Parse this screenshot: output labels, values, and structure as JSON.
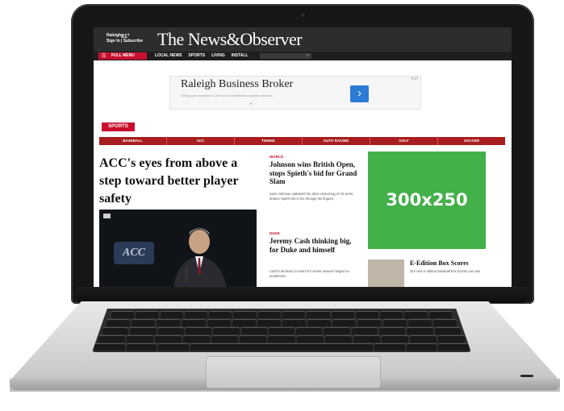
{
  "header": {
    "weather_label": "Raleigh",
    "subscribe_label": "Sign In | Subscribe",
    "temperature": "81°",
    "masthead": "The News&Observer"
  },
  "nav": {
    "menu_label": "FULL MENU",
    "links": [
      "LOCAL NEWS",
      "SPORTS",
      "LIVING",
      "INSTALL"
    ]
  },
  "ad": {
    "title": "Raleigh Business Broker",
    "subtitle": "Selling your business? Call us for confidential complete services",
    "close": "AdX",
    "arrow": "›"
  },
  "section": {
    "tag": "SPORTS",
    "subnav": [
      "BASEBALL",
      "ACC",
      "TENNIS",
      "AUTO RACING",
      "GOLF",
      "SOCCER"
    ]
  },
  "lead": {
    "headline": "ACC's eyes from above a step toward better player safety"
  },
  "stories": [
    {
      "kicker": "WORLD",
      "title": "Johnson wins British Open, stops Spieth's bid for Grand Slam",
      "body": "Zach Johnson outlasted the drive closed lug in his arms, broken Spieth ins in his through his fingers."
    },
    {
      "kicker": "DUKE",
      "title": "Jeremy Cash thinking big, for Duke and himself",
      "body": "Cash's decision to return for senior season hinged on academics"
    }
  ],
  "sidebar": {
    "ad_label": "300x250",
    "edition_title": "E-Edition Box Scores",
    "edition_body": "Our new e-edition baseball box scores out now"
  },
  "colors": {
    "brand_red": "#c8102e",
    "subnav_red": "#a81d1d",
    "ad_green": "#44b04a",
    "ad_button_blue": "#2c7bd6"
  }
}
